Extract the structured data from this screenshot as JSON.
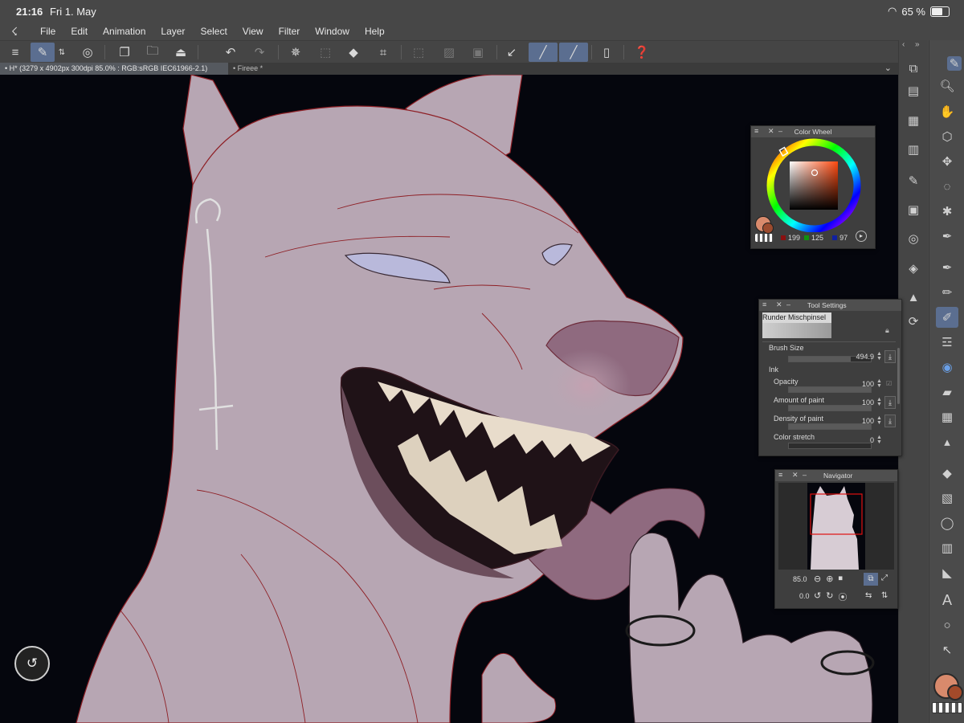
{
  "status_bar": {
    "time": "21:16",
    "date": "Fri 1. May",
    "battery": "65 %"
  },
  "menu": {
    "items": [
      "File",
      "Edit",
      "Animation",
      "Layer",
      "Select",
      "View",
      "Filter",
      "Window",
      "Help"
    ]
  },
  "tabs": [
    {
      "label": "H* (3279 x 4902px 300dpi 85.0% : RGB:sRGB IEC61966-2.1)",
      "active": true
    },
    {
      "label": "Fireee *",
      "active": false
    }
  ],
  "color_wheel": {
    "title": "Color Wheel",
    "r": "199",
    "g": "125",
    "b": "97",
    "current_color": "#c77d61"
  },
  "tool_settings": {
    "title": "Tool Settings",
    "brush_name": "Runder Mischpinsel",
    "brush_size_label": "Brush Size",
    "brush_size_value": "494.9",
    "brush_size_fraction": 0.75,
    "ink_label": "Ink",
    "opacity_label": "Opacity",
    "opacity_value": "100",
    "opacity_fraction": 1.0,
    "amount_label": "Amount of paint",
    "amount_value": "100",
    "amount_fraction": 1.0,
    "density_label": "Density of paint",
    "density_value": "100",
    "density_fraction": 1.0,
    "stretch_label": "Color stretch",
    "stretch_value": "0",
    "stretch_fraction": 0.0
  },
  "navigator": {
    "title": "Navigator",
    "zoom": "85.0",
    "rotation": "0.0"
  },
  "colors": {
    "accent": "#5b6e90",
    "canvas_bg": "#05060d",
    "skin": "#b7a6b3",
    "line": "#8e1f25",
    "main_color": "#d98a6c"
  }
}
